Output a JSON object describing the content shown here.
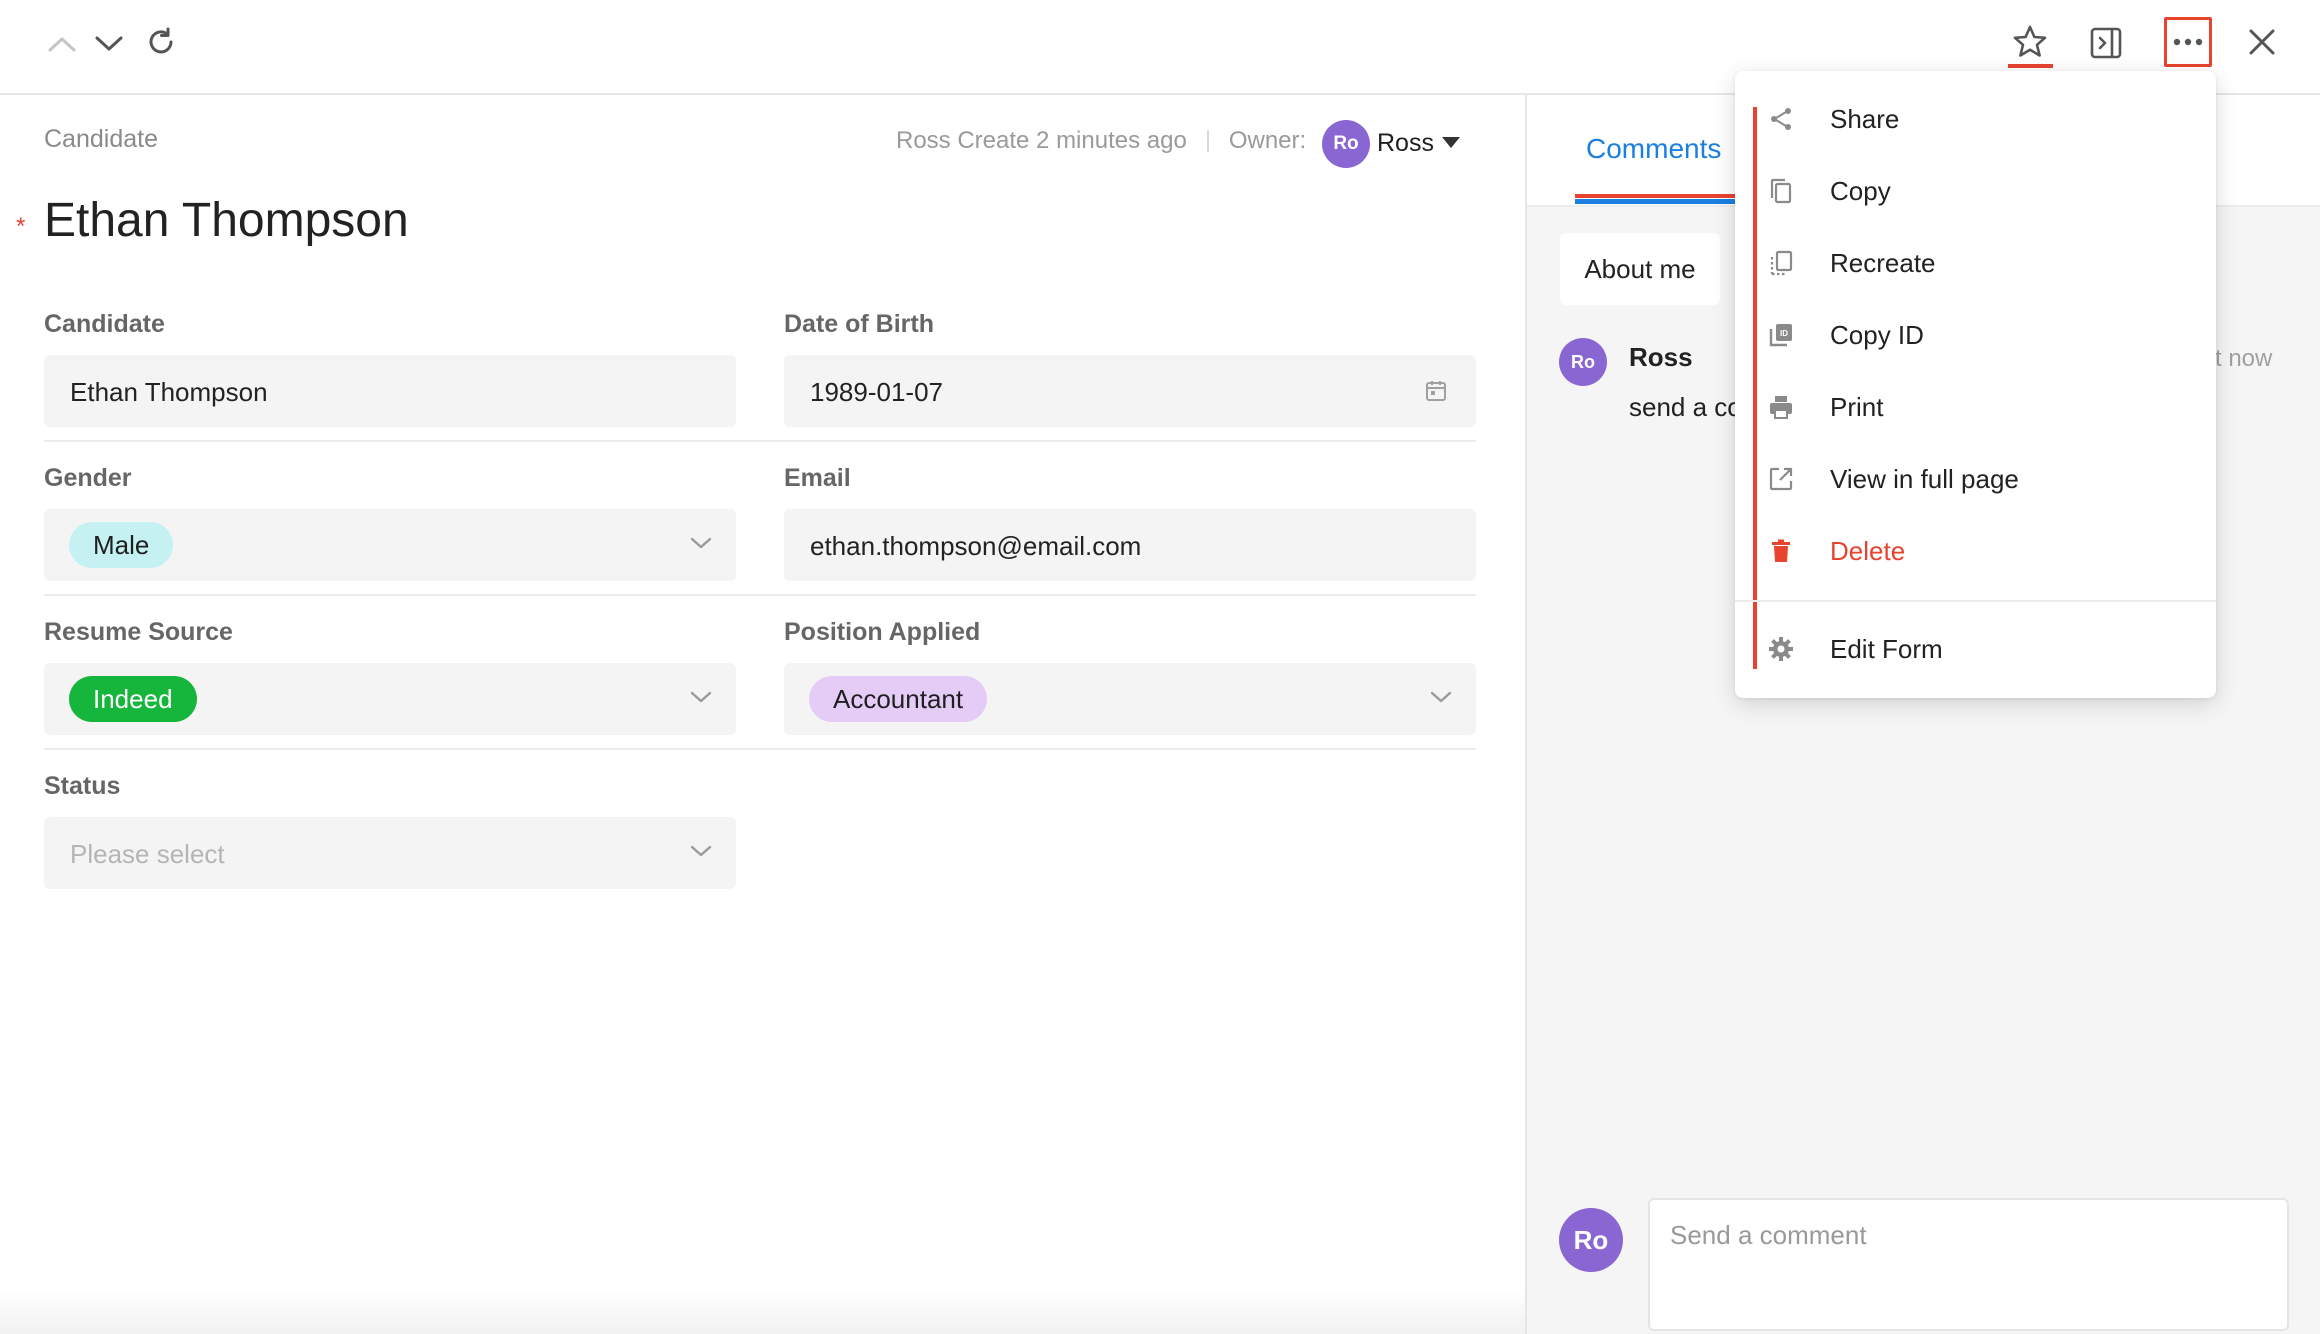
{
  "topbar": {
    "prev_icon": "chevron-up-icon",
    "next_icon": "chevron-down-icon",
    "refresh_icon": "refresh-icon",
    "star_icon": "star-icon",
    "panel_icon": "side-panel-icon",
    "more_icon": "more-horizontal-icon",
    "close_icon": "close-icon",
    "highlight_color": "#e8432f"
  },
  "record": {
    "breadcrumb": "Candidate",
    "meta_created": "Ross Create 2 minutes ago",
    "owner_label": "Owner:",
    "owner_initials": "Ro",
    "owner_name": "Ross",
    "title": "Ethan Thompson"
  },
  "form": {
    "candidate": {
      "label": "Candidate",
      "required_mark": "*",
      "value": "Ethan Thompson"
    },
    "dob": {
      "label": "Date of Birth",
      "value": "1989-01-07",
      "icon": "calendar-icon"
    },
    "gender": {
      "label": "Gender",
      "value": "Male",
      "tag_bg": "#c6f1f2"
    },
    "email": {
      "label": "Email",
      "value": "ethan.thompson@email.com"
    },
    "resume_source": {
      "label": "Resume Source",
      "value": "Indeed",
      "tag_bg": "#16b53c"
    },
    "position": {
      "label": "Position Applied",
      "value": "Accountant",
      "tag_bg": "#e4ccf7"
    },
    "status": {
      "label": "Status",
      "placeholder": "Please select"
    }
  },
  "sidebar": {
    "tab_comments": "Comments",
    "about_me": "About me",
    "comment": {
      "avatar": "Ro",
      "author": "Ross",
      "time": "t now",
      "text": "send a co"
    },
    "composer": {
      "avatar": "Ro",
      "placeholder": "Send a comment"
    },
    "accent_color": "#1a7fe0"
  },
  "menu": {
    "items": [
      {
        "label": "Share",
        "icon": "share-icon"
      },
      {
        "label": "Copy",
        "icon": "copy-icon"
      },
      {
        "label": "Recreate",
        "icon": "recreate-icon"
      },
      {
        "label": "Copy ID",
        "icon": "copy-id-icon"
      },
      {
        "label": "Print",
        "icon": "print-icon"
      },
      {
        "label": "View in full page",
        "icon": "external-link-icon"
      },
      {
        "label": "Delete",
        "icon": "trash-icon",
        "danger": true
      },
      {
        "label": "Edit Form",
        "icon": "gear-icon"
      }
    ],
    "danger_color": "#e8432f"
  }
}
